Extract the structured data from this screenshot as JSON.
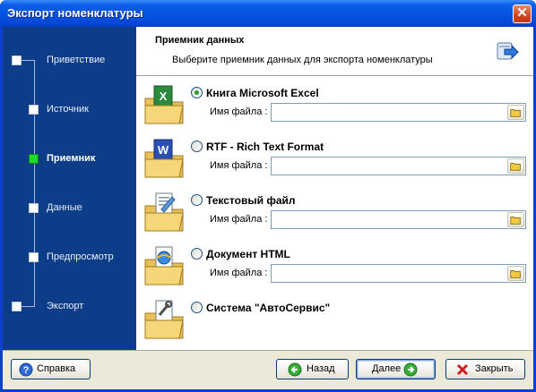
{
  "window": {
    "title": "Экспорт номенклатуры",
    "close_label": "✕"
  },
  "sidebar": {
    "steps": [
      {
        "label": "Приветствие",
        "active": false
      },
      {
        "label": "Источник",
        "active": false
      },
      {
        "label": "Приемник",
        "active": true
      },
      {
        "label": "Данные",
        "active": false
      },
      {
        "label": "Предпросмотр",
        "active": false
      },
      {
        "label": "Экспорт",
        "active": false
      }
    ]
  },
  "header": {
    "title": "Приемник данных",
    "subtitle": "Выберите приемник данных для экспорта номенклатуры"
  },
  "options": [
    {
      "label": "Книга Microsoft Excel",
      "checked": true,
      "file_label": "Имя файла :",
      "file_value": "",
      "icon": "excel-folder-icon"
    },
    {
      "label": "RTF - Rich Text Format",
      "checked": false,
      "file_label": "Имя файла :",
      "file_value": "",
      "icon": "word-folder-icon"
    },
    {
      "label": "Текстовый файл",
      "checked": false,
      "file_label": "Имя файла :",
      "file_value": "",
      "icon": "text-folder-icon"
    },
    {
      "label": "Документ HTML",
      "checked": false,
      "file_label": "Имя файла :",
      "file_value": "",
      "icon": "html-folder-icon"
    },
    {
      "label": "Система \"АвтоСервис\"",
      "checked": false,
      "icon": "autoservice-folder-icon"
    }
  ],
  "buttons": {
    "help": "Справка",
    "back": "Назад",
    "next": "Далее",
    "close": "Закрыть"
  },
  "colors": {
    "titlebar": "#0553e0",
    "sidebar": "#0d3d89",
    "active_step": "#21d82c",
    "face": "#ece9d8"
  }
}
